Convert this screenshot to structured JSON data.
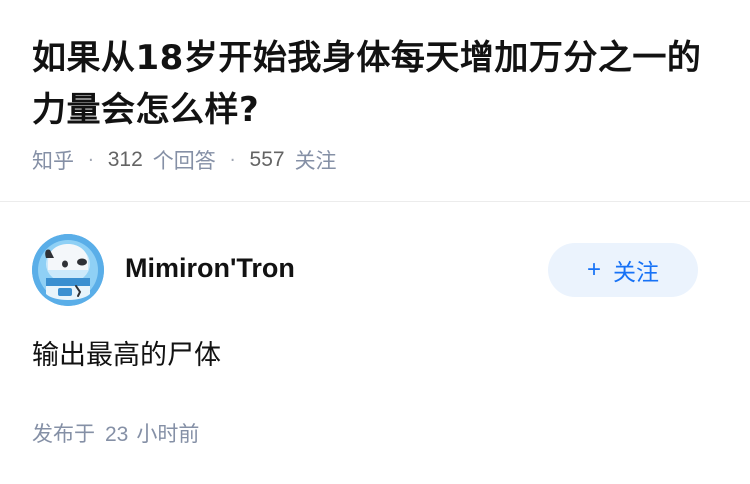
{
  "question": {
    "title": "如果从18岁开始我身体每天增加万分之一的力量会怎么样?",
    "source": "知乎",
    "answer_count": "312",
    "answer_label": "个回答",
    "follower_count": "557",
    "follower_label": "关注",
    "separator": "·"
  },
  "answer": {
    "author_name": "Mimiron'Tron",
    "follow_label": "关注",
    "follow_icon": "plus-icon",
    "content": "输出最高的尸体",
    "published_prefix": "发布于",
    "published_value": "23",
    "published_unit": "小时前"
  },
  "colors": {
    "accent": "#1772f6",
    "follow_bg": "#ebf3fd",
    "meta_text": "#8590a6",
    "avatar_bg": "#5aaee8"
  }
}
